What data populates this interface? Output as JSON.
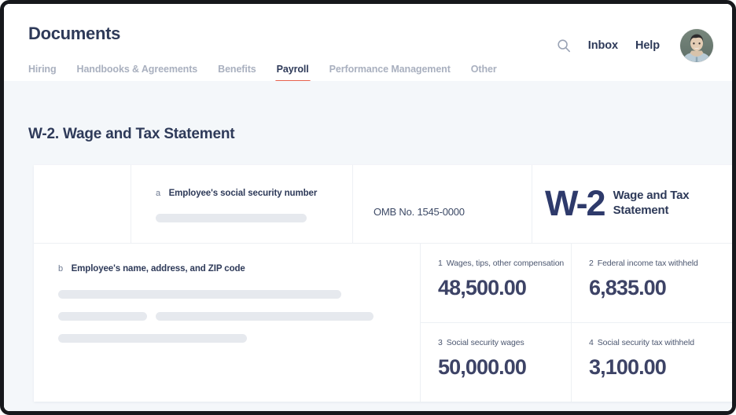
{
  "header": {
    "app_title": "Documents",
    "search_icon": "search-icon",
    "inbox_label": "Inbox",
    "help_label": "Help",
    "avatar_alt": "user-avatar",
    "accent_color": "#e8614d",
    "text_color": "#2e3a59"
  },
  "tabs": [
    {
      "label": "Hiring",
      "active": false
    },
    {
      "label": "Handbooks & Agreements",
      "active": false
    },
    {
      "label": "Benefits",
      "active": false
    },
    {
      "label": "Payroll",
      "active": true
    },
    {
      "label": "Performance Management",
      "active": false
    },
    {
      "label": "Other",
      "active": false
    }
  ],
  "main": {
    "page_title": "W-2. Wage and Tax Statement"
  },
  "form": {
    "ssn": {
      "tag": "a",
      "label": "Employee's social security number",
      "value_redacted": true
    },
    "omb": {
      "text": "OMB No. 1545-0000"
    },
    "logo": {
      "mark": "W-2",
      "subtitle": "Wage and Tax Statement"
    },
    "employee": {
      "tag": "b",
      "label": "Employee's name, address, and ZIP code",
      "value_redacted": true
    },
    "boxes": [
      {
        "num": "1",
        "label": "Wages, tips, other compensation",
        "value": "48,500.00"
      },
      {
        "num": "2",
        "label": "Federal income tax withheld",
        "value": "6,835.00"
      },
      {
        "num": "3",
        "label": "Social security wages",
        "value": "50,000.00"
      },
      {
        "num": "4",
        "label": "Social security tax withheld",
        "value": "3,100.00"
      }
    ]
  }
}
